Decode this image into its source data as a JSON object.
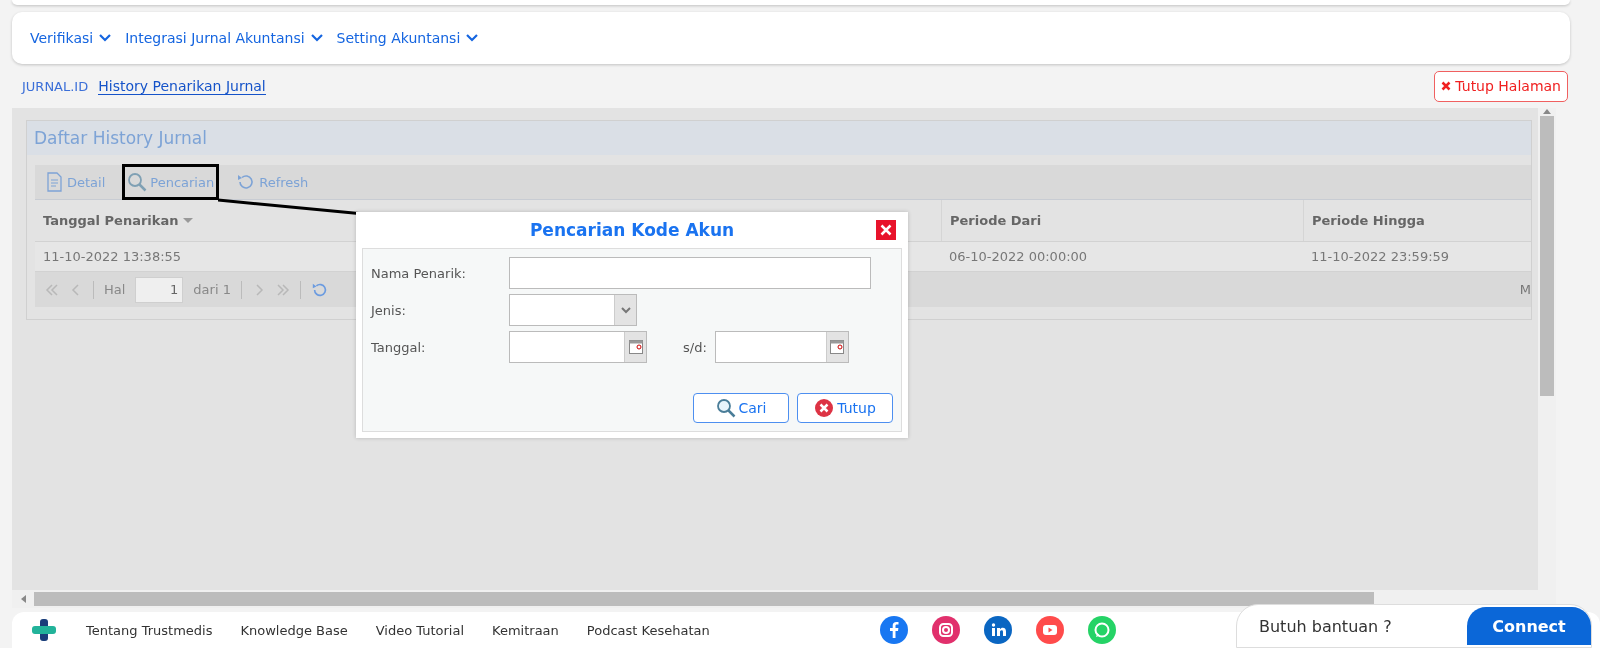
{
  "nav": [
    {
      "label": "Verifikasi"
    },
    {
      "label": "Integrasi Jurnal Akuntansi"
    },
    {
      "label": "Setting Akuntansi"
    }
  ],
  "breadcrumb": {
    "root": "JURNAL.ID",
    "current": "History Penarikan Jurnal"
  },
  "close_page": "Tutup Halaman",
  "panel": {
    "title": "Daftar History Jurnal",
    "toolbar": [
      {
        "kind": "detail",
        "label": "Detail",
        "highlighted": false
      },
      {
        "kind": "search",
        "label": "Pencarian",
        "highlighted": true
      },
      {
        "kind": "refresh",
        "label": "Refresh",
        "highlighted": false
      }
    ],
    "columns": [
      {
        "label": "Tanggal Penarikan",
        "sorted": true
      },
      {
        "label": "Periode Dari",
        "sorted": false
      },
      {
        "label": "Periode Hingga",
        "sorted": false
      }
    ],
    "rows": [
      {
        "cells": [
          "11-10-2022 13:38:55",
          "06-10-2022 00:00:00",
          "11-10-2022 23:59:59"
        ]
      }
    ],
    "pager": {
      "page_label": "Hal",
      "page": "1",
      "of": "dari 1",
      "info": "M"
    }
  },
  "dialog": {
    "title": "Pencarian Kode Akun",
    "fields": [
      {
        "kind": "text",
        "label": "Nama Penarik:"
      },
      {
        "kind": "select",
        "label": "Jenis:"
      },
      {
        "kind": "daterange",
        "label": "Tanggal:",
        "separator": "s/d:"
      }
    ],
    "buttons": [
      {
        "kind": "search",
        "label": "Cari"
      },
      {
        "kind": "close",
        "label": "Tutup"
      }
    ]
  },
  "footer": {
    "links": [
      "Tentang Trustmedis",
      "Knowledge Base",
      "Video Tutorial",
      "Kemitraan",
      "Podcast Kesehatan"
    ],
    "social": [
      {
        "kind": "facebook",
        "color": "#1877f2"
      },
      {
        "kind": "instagram",
        "color": "#e1306c"
      },
      {
        "kind": "linkedin",
        "color": "#0a66c2"
      },
      {
        "kind": "youtube",
        "color": "#ff4b4b"
      },
      {
        "kind": "whatsapp",
        "color": "#25d366"
      }
    ],
    "help": "Butuh bantuan ?",
    "connect": "Connect"
  }
}
